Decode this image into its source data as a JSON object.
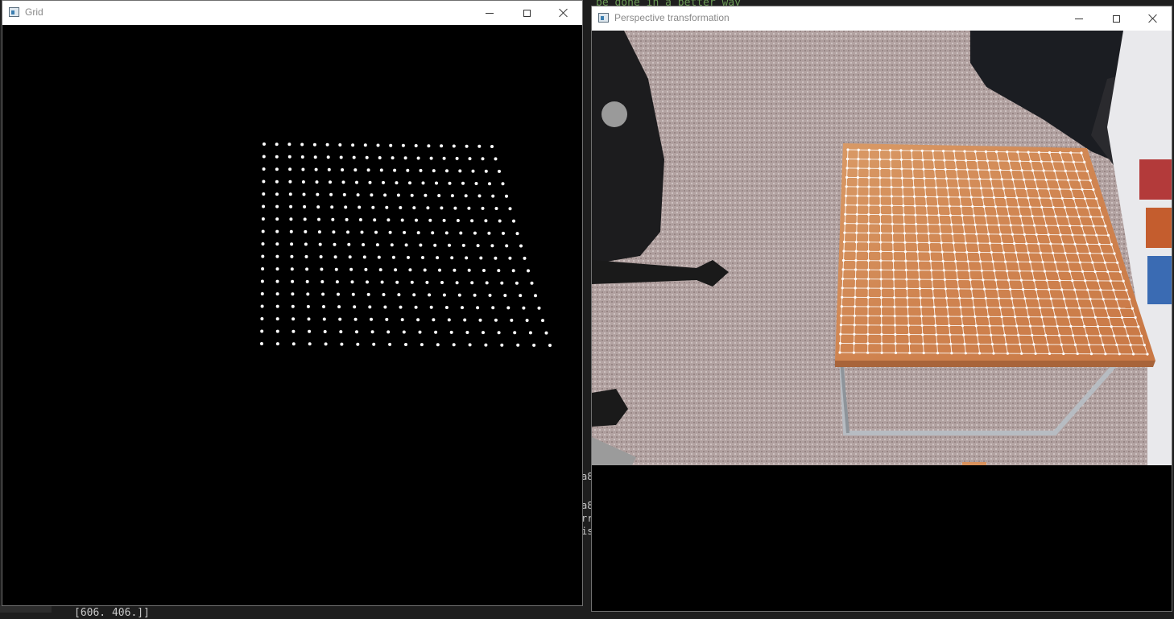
{
  "terminal": {
    "top_line": "be done in a better way",
    "side_lines": [
      "a8",
      "",
      "a8",
      "rr",
      "is"
    ],
    "bottom_line": "[606. 406.]]"
  },
  "grid_window": {
    "title": "Grid",
    "controls": {
      "minimize_icon": "minimize-icon",
      "maximize_icon": "maximize-icon",
      "close_icon": "close-icon"
    }
  },
  "perspective_window": {
    "title": "Perspective transformation",
    "controls": {
      "minimize_icon": "minimize-icon",
      "maximize_icon": "maximize-icon",
      "close_icon": "close-icon"
    }
  },
  "colors": {
    "canvas_bg": "#000000",
    "dot": "#ffffff",
    "table_wood": "#d8915c",
    "carpet": "#b8a8a6",
    "grid_line": "#ffffff"
  }
}
